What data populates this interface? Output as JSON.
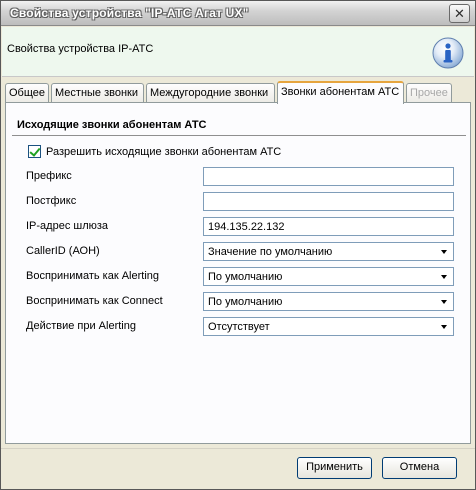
{
  "window": {
    "title": "Свойства устройства \"IP-АТС Агат UX\"",
    "close_glyph": "✕"
  },
  "header": {
    "text": "Свойства устройства IP-АТС",
    "icon": "info-icon"
  },
  "tabs": [
    {
      "label": "Общее",
      "active": false,
      "enabled": true
    },
    {
      "label": "Местные звонки",
      "active": false,
      "enabled": true
    },
    {
      "label": "Междугородние звонки",
      "active": false,
      "enabled": true
    },
    {
      "label": "Звонки абонентам АТС",
      "active": true,
      "enabled": true
    },
    {
      "label": "Прочее",
      "active": false,
      "enabled": false
    }
  ],
  "group": {
    "title": "Исходящие звонки абонентам АТС",
    "allow_checkbox": {
      "label": "Разрешить исходящие звонки абонентам АТС",
      "checked": true
    }
  },
  "fields": {
    "prefix": {
      "label": "Префикс",
      "value": ""
    },
    "postfix": {
      "label": "Постфикс",
      "value": ""
    },
    "gateway": {
      "label": "IP-адрес шлюза",
      "value": "194.135.22.132"
    },
    "callerid": {
      "label": "CallerID (АОН)",
      "value": "Значение по умолчанию"
    },
    "alerting": {
      "label": "Воспринимать как Alerting",
      "value": "По умолчанию"
    },
    "connect": {
      "label": "Воспринимать как Connect",
      "value": "По умолчанию"
    },
    "action_alerting": {
      "label": "Действие при Alerting",
      "value": "Отсутствует"
    }
  },
  "buttons": {
    "apply": "Применить",
    "cancel": "Отмена"
  },
  "colors": {
    "header_band": "#eef8ee",
    "active_tab_accent": "#e6a53e",
    "info_icon": "#2a64c4"
  }
}
